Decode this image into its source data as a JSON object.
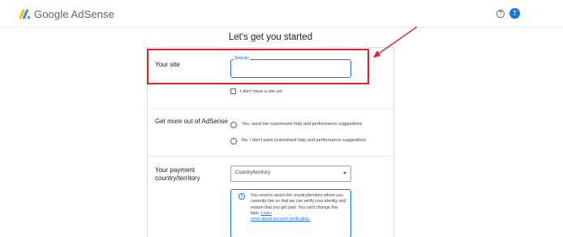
{
  "header": {
    "logo_text": "Google AdSense",
    "help_icon_glyph": "?",
    "avatar_initial": "T"
  },
  "main": {
    "title": "Let's get you started",
    "site_section": {
      "label": "Your site",
      "website_field_label": "Website",
      "website_value": "",
      "no_site_checkbox_label": "I don't have a site yet",
      "no_site_checked": false
    },
    "adsense_section": {
      "label": "Get more out of AdSense",
      "options": [
        {
          "label": "Yes, send me customised help and performance suggestions",
          "selected": false
        },
        {
          "label": "No, I don't want customised help and performance suggestions",
          "selected": false
        }
      ]
    },
    "payment_section": {
      "label_line1": "Your payment",
      "label_line2": "country/territory",
      "select_value": "Country/territory",
      "info_icon_glyph": "i",
      "info_text": "You need to select the country/territory where you currently live so that we can verify your identity and ensure that you get paid. You can't change this later. ",
      "info_link_line1": "Learn",
      "info_link_line2": "more about account verification."
    }
  },
  "annotation": {
    "highlight_color": "#e0202a"
  },
  "colors": {
    "accent": "#1a73e8",
    "text": "#202124",
    "border": "#dadce0"
  }
}
